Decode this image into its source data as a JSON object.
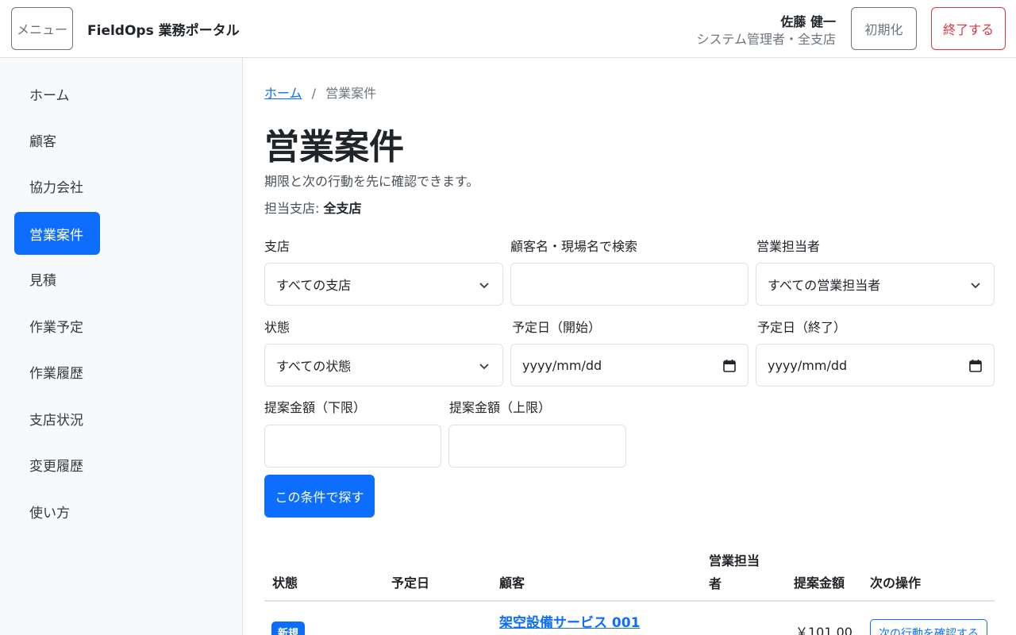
{
  "header": {
    "menu_label": "メニュー",
    "app_title": "FieldOps 業務ポータル",
    "user_name": "佐藤 健一",
    "user_role": "システム管理者・全支店",
    "reset_label": "初期化",
    "exit_label": "終了する"
  },
  "sidebar": {
    "items": [
      {
        "label": "ホーム"
      },
      {
        "label": "顧客"
      },
      {
        "label": "協力会社"
      },
      {
        "label": "営業案件",
        "active": true
      },
      {
        "label": "見積"
      },
      {
        "label": "作業予定"
      },
      {
        "label": "作業履歴"
      },
      {
        "label": "支店状況"
      },
      {
        "label": "変更履歴"
      },
      {
        "label": "使い方"
      }
    ]
  },
  "breadcrumb": {
    "home": "ホーム",
    "separator": "/",
    "current": "営業案件"
  },
  "page": {
    "title": "営業案件",
    "subtitle": "期限と次の行動を先に確認できます。",
    "branch_prefix": "担当支店: ",
    "branch_value": "全支店"
  },
  "filters": {
    "branch_label": "支店",
    "branch_value": "すべての支店",
    "search_label": "顧客名・現場名で検索",
    "search_value": "",
    "owner_label": "営業担当者",
    "owner_value": "すべての営業担当者",
    "status_label": "状態",
    "status_value": "すべての状態",
    "date_from_label": "予定日（開始）",
    "date_from_value": "yyyy/mm/dd",
    "date_to_label": "予定日（終了）",
    "date_to_value": "yyyy/mm/dd",
    "amount_min_label": "提案金額（下限）",
    "amount_min_value": "",
    "amount_max_label": "提案金額（上限）",
    "amount_max_value": "",
    "search_button": "この条件で探す"
  },
  "table": {
    "headers": {
      "status": "状態",
      "date": "予定日",
      "customer": "顧客",
      "owner_line1": "営業担当",
      "owner_line2": "者",
      "amount": "提案金額",
      "action": "次の操作"
    },
    "rows": [
      {
        "status": "新規",
        "customer": "架空設備サービス 001",
        "amount": "￥101,00",
        "action": "次の行動を確認する"
      }
    ]
  },
  "colors": {
    "primary": "#0d6efd",
    "danger": "#dc3545",
    "secondary": "#6c757d"
  }
}
